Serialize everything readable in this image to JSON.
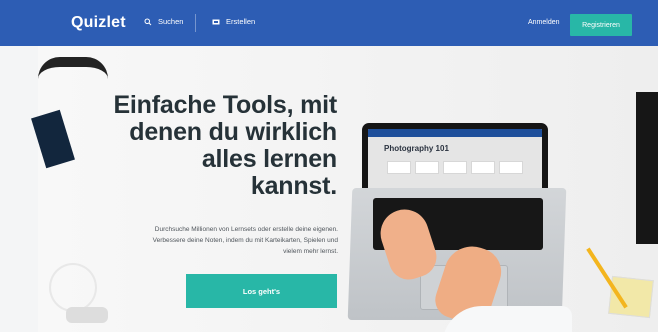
{
  "brand": "Quizlet",
  "nav": {
    "search": "Suchen",
    "create": "Erstellen",
    "login": "Anmelden",
    "register": "Registrieren"
  },
  "hero": {
    "headline_lines": [
      "Einfache Tools, mit",
      "denen du wirklich",
      "alles lernen",
      "kannst."
    ],
    "subtext_lines": [
      "Durchsuche Millionen von Lernsets oder erstelle deine eigenen.",
      "Verbessere deine Noten, indem du mit Karteikarten, Spielen und",
      "vielem mehr lernst."
    ],
    "cta": "Los geht's"
  },
  "laptop_screen_title": "Photography 101",
  "icons": {
    "search": "search-icon",
    "create": "create-icon"
  },
  "colors": {
    "topbar": "#2d5db4",
    "accent": "#28b7a7",
    "headline": "#263238"
  }
}
